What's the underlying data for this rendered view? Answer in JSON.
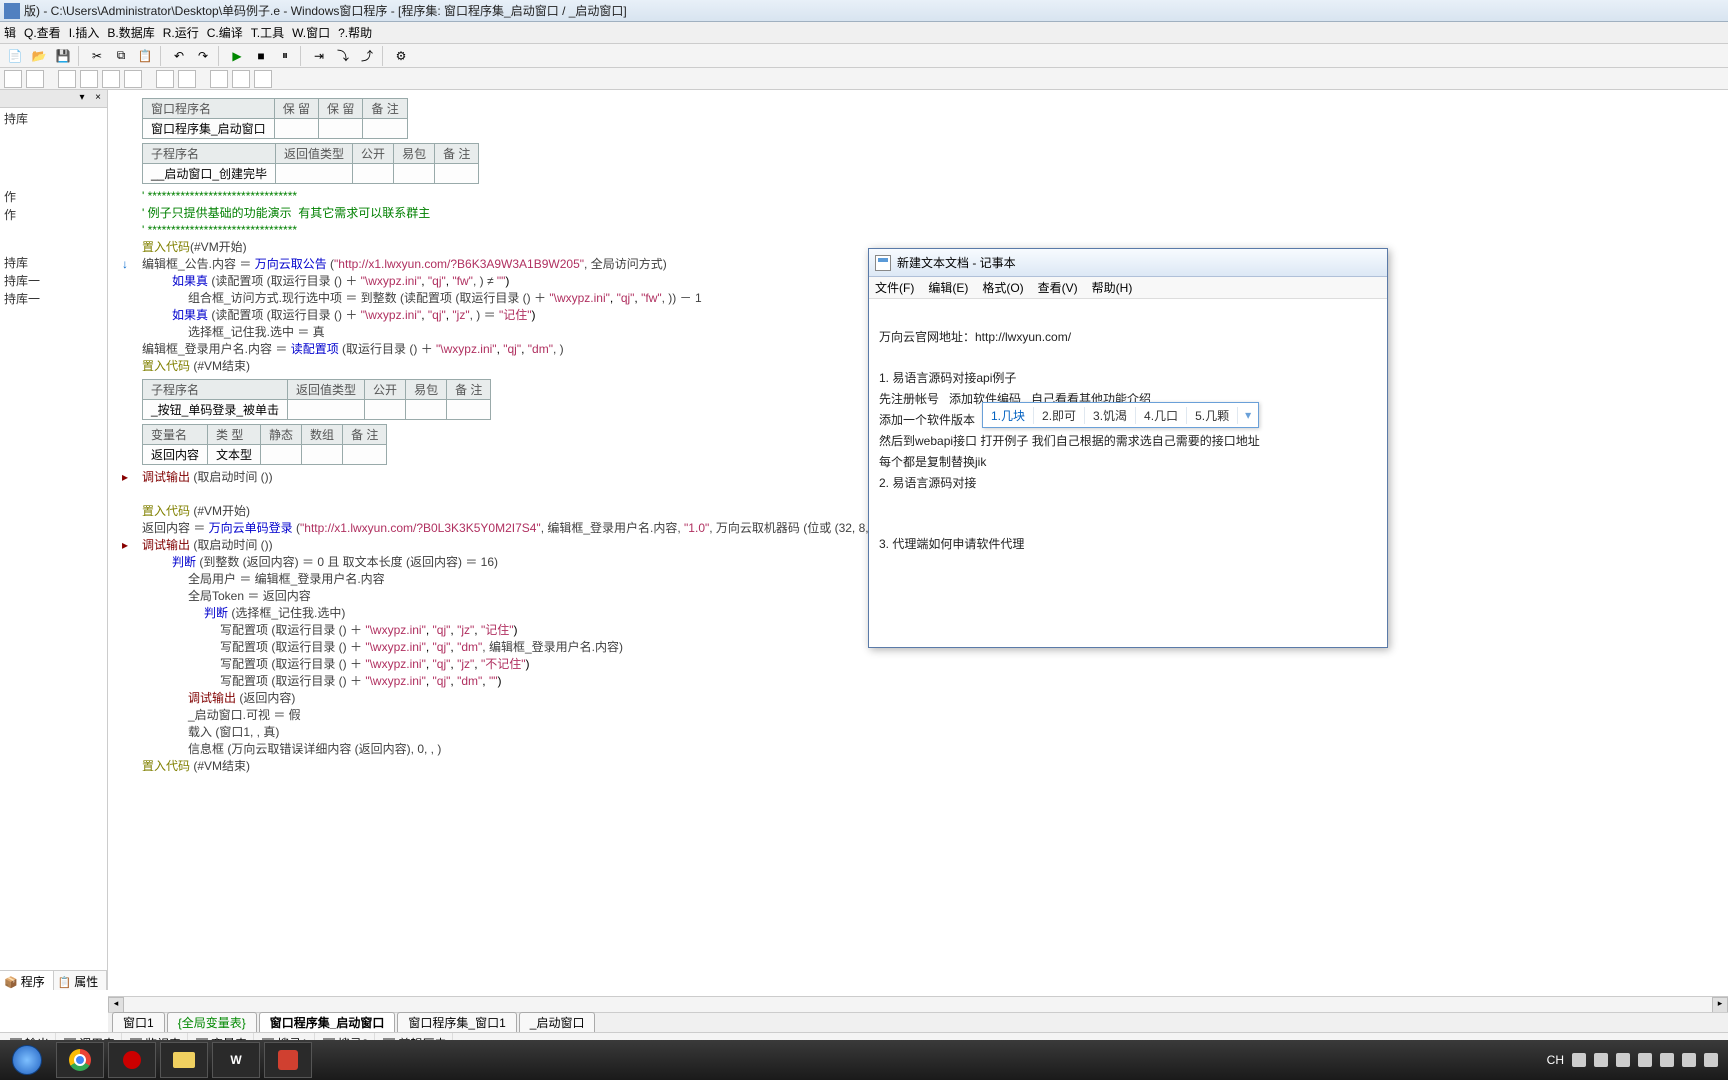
{
  "titlebar": "版) - C:\\Users\\Administrator\\Desktop\\单码例子.e - Windows窗口程序 - [程序集: 窗口程序集_启动窗口 / _启动窗口]",
  "menu": [
    "辑",
    "Q.查看",
    "I.插入",
    "B.数据库",
    "R.运行",
    "C.编译",
    "T.工具",
    "W.窗口",
    "?.帮助"
  ],
  "sidebar": {
    "items": [
      "持库",
      "",
      "",
      "",
      "作",
      "作",
      "",
      "持库",
      "持库一",
      "持库一"
    ],
    "tabs": [
      "程序",
      "属性"
    ],
    "close": "×",
    "pin": "▾"
  },
  "tables": {
    "t1": {
      "h": [
        "窗口程序名",
        "保 留",
        "保 留",
        "备 注"
      ],
      "r": [
        "窗口程序集_启动窗口",
        "",
        "",
        ""
      ]
    },
    "t2": {
      "h": [
        "子程序名",
        "返回值类型",
        "公开",
        "易包",
        "备 注"
      ],
      "r": [
        "__启动窗口_创建完毕",
        "",
        "",
        "",
        ""
      ]
    },
    "t3": {
      "h": [
        "子程序名",
        "返回值类型",
        "公开",
        "易包",
        "备 注"
      ],
      "r": [
        "_按钮_单码登录_被单击",
        "",
        "",
        "",
        ""
      ]
    },
    "t4": {
      "h": [
        "变量名",
        "类 型",
        "静态",
        "数组",
        "备 注"
      ],
      "r": [
        "返回内容",
        "文本型",
        "",
        "",
        ""
      ]
    }
  },
  "code": {
    "l0": "' ********************************",
    "l1": "' 例子只提供基础的功能演示  有其它需求可以联系群主",
    "l2": "' ********************************",
    "l3a": "置入代码",
    "l3b": "(#VM开始)",
    "l4a": "编辑框_公告.内容 ＝ ",
    "l4b": "万向云取公告",
    "l4c": " (",
    "l4d": "\"http://x1.lwxyun.com/?B6K3A9W3A1B9W205\"",
    "l4e": ", 全局访问方式)",
    "l5a": "如果真",
    "l5b": " (读配置项 (取运行目录 () ＋ ",
    "l5c": "\"\\wxypz.ini\"",
    "l5d": ", ",
    "l5e": "\"qj\"",
    "l5f": ", ",
    "l5g": "\"fw\"",
    "l5h": ", ) ≠ ",
    "l5i": "\"\"",
    "l5j": ")",
    "l6a": "组合框_访问方式.现行选中项 ＝ 到整数 (读配置项 (取运行目录 () ＋ ",
    "l6b": "\"\\wxypz.ini\"",
    "l6c": ", ",
    "l6d": "\"qj\"",
    "l6e": ", ",
    "l6f": "\"fw\"",
    "l6g": ", )) － 1",
    "l7a": "如果真",
    "l7b": " (读配置项 (取运行目录 () ＋ ",
    "l7c": "\"\\wxypz.ini\"",
    "l7d": ", ",
    "l7e": "\"qj\"",
    "l7f": ", ",
    "l7g": "\"jz\"",
    "l7h": ", ) ＝ ",
    "l7i": "\"记住\"",
    "l7j": ")",
    "l8": "选择框_记住我.选中 ＝ 真",
    "l9a": "编辑框_登录用户名.内容 ＝ ",
    "l9b": "读配置项",
    "l9c": " (取运行目录 () ＋ ",
    "l9d": "\"\\wxypz.ini\"",
    "l9e": ", ",
    "l9f": "\"qj\"",
    "l9g": ", ",
    "l9h": "\"dm\"",
    "l9i": ", )",
    "l10a": "置入代码",
    "l10b": " (#VM结束)",
    "l11a": "调试输出",
    "l11b": " (取启动时间 ())",
    "l12a": "置入代码",
    "l12b": " (#VM开始)",
    "l13a": "返回内容 ＝ ",
    "l13b": "万向云单码登录",
    "l13c": " (",
    "l13d": "\"http://x1.lwxyun.com/?B0L3K3K5Y0M2I7S4\"",
    "l13e": ", 编辑框_登录用户名.内容, ",
    "l13f": "\"1.0\"",
    "l13g": ", 万向云取机器码 (位或 (32, 8, 128)), 全局访问",
    "l14a": "调试输出",
    "l14b": " (取启动时间 ())",
    "l15a": "判断",
    "l15b": " (到整数 (返回内容) ＝ 0 且 取文本长度 (返回内容) ＝ 16)",
    "l16": "全局用户 ＝ 编辑框_登录用户名.内容",
    "l17": "全局Token ＝ 返回内容",
    "l18a": "判断",
    "l18b": " (选择框_记住我.选中)",
    "l19a": "写配置项 (取运行目录 () ＋ ",
    "l19b": "\"\\wxypz.ini\"",
    "l19c": ", ",
    "l19d": "\"qj\"",
    "l19e": ", ",
    "l19f": "\"jz\"",
    "l19g": ", ",
    "l19h": "\"记住\"",
    "l19i": ")",
    "l20a": "写配置项 (取运行目录 () ＋ ",
    "l20b": "\"\\wxypz.ini\"",
    "l20c": ", ",
    "l20d": "\"qj\"",
    "l20e": ", ",
    "l20f": "\"dm\"",
    "l20g": ", 编辑框_登录用户名.内容)",
    "l21a": "写配置项 (取运行目录 () ＋ ",
    "l21b": "\"\\wxypz.ini\"",
    "l21c": ", ",
    "l21d": "\"qj\"",
    "l21e": ", ",
    "l21f": "\"jz\"",
    "l21g": ", ",
    "l21h": "\"不记住\"",
    "l21i": ")",
    "l22a": "写配置项 (取运行目录 () ＋ ",
    "l22b": "\"\\wxypz.ini\"",
    "l22c": ", ",
    "l22d": "\"qj\"",
    "l22e": ", ",
    "l22f": "\"dm\"",
    "l22g": ", ",
    "l22h": "\"\"",
    "l22i": ")",
    "l23a": "调试输出",
    "l23b": " (返回内容)",
    "l24": "_启动窗口.可视 ＝ 假",
    "l25": "载入 (窗口1, , 真)",
    "l26": "信息框 (万向云取错误详细内容 (返回内容), 0, , )",
    "l27a": "置入代码",
    "l27b": " (#VM结束)"
  },
  "bottabs": [
    "窗口1",
    "{全局变量表}",
    "窗口程序集_启动窗口",
    "窗口程序集_窗口1",
    "_启动窗口"
  ],
  "output_tabs": [
    "输出",
    "调用表",
    "监视表",
    "变量表",
    "搜寻1",
    "搜寻2",
    "剪辑历史"
  ],
  "notepad": {
    "title": "新建文本文档 - 记事本",
    "menu": [
      "文件(F)",
      "编辑(E)",
      "格式(O)",
      "查看(V)",
      "帮助(H)",
      ""
    ],
    "body_lines": [
      "万向云官网地址：http://lwxyun.com/",
      "",
      "1. 易语言源码对接api例子",
      "先注册帐号   添加软件编码   自己看看其他功能介绍",
      "添加一个软件版本  我们默认例子是1.0需要其他的自行修改",
      "然后到webapi接口 打开例子 我们自己根据的需求选自己需要的接口地址",
      "每个都是复制替换jik",
      "2. 易语言源码对接",
      "",
      "",
      "3. 代理端如何申请软件代理"
    ]
  },
  "ime": {
    "cands": [
      "1.几块",
      "2.即可",
      "3.饥渴",
      "4.几口",
      "5.几颗"
    ]
  },
  "tray": {
    "lang": "CH",
    "time": ""
  }
}
